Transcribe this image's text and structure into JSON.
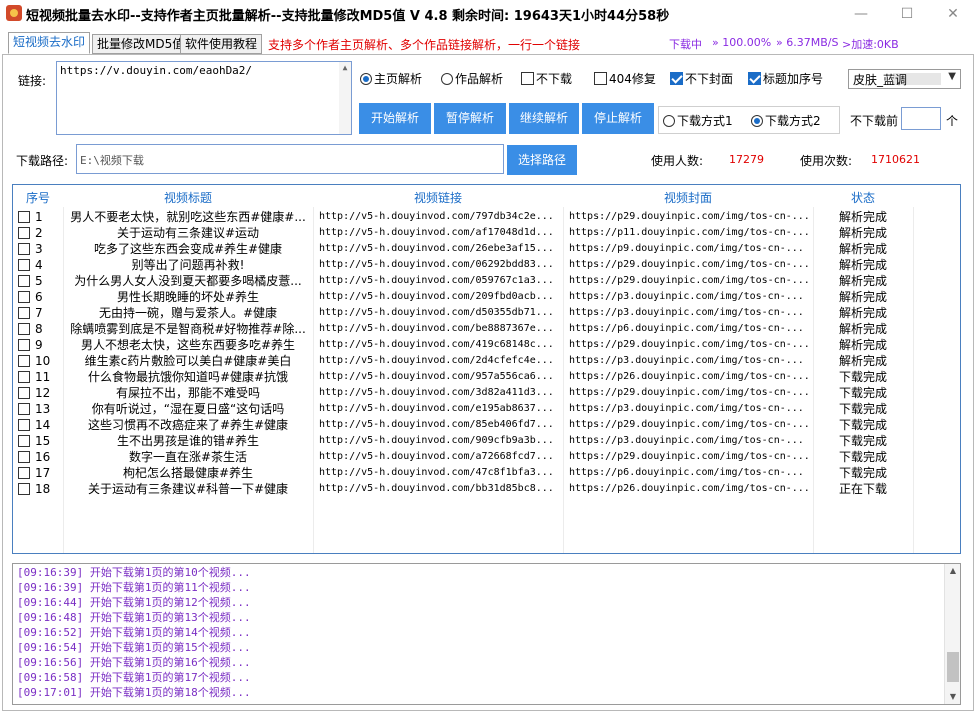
{
  "app": {
    "title": "短视频批量去水印--支持作者主页批量解析--支持批量修改MD5值 V 4.8     剩余时间:  19643天1小时44分58秒"
  },
  "window_controls": {
    "minimize": "—",
    "maximize": "☐",
    "close": "✕"
  },
  "tabs": [
    {
      "label": "短视频去水印",
      "active": true
    },
    {
      "label": "批量修改MD5值",
      "active": false
    },
    {
      "label": "软件使用教程",
      "active": false
    }
  ],
  "tab_hint": "支持多个作者主页解析、多个作品链接解析，一行一个链接",
  "status": {
    "downloading": "下载中",
    "percent": "» 100.00%",
    "speed": "» 6.37MB/S",
    "accel": ">加速:0KB"
  },
  "link": {
    "label": "链接:",
    "value": "https://v.douyin.com/eaohDa2/"
  },
  "options": {
    "homepage_parse": "主页解析",
    "work_parse": "作品解析",
    "no_download": "不下载",
    "fix_404": "404修复",
    "no_cover": "不下封面",
    "title_index": "标题加序号"
  },
  "skin": {
    "value": "皮肤_蓝调"
  },
  "buttons": {
    "start": "开始解析",
    "pause": "暂停解析",
    "resume": "继续解析",
    "stop": "停止解析",
    "choose_path": "选择路径"
  },
  "download_mode": {
    "mode1": "下载方式1",
    "mode2": "下载方式2"
  },
  "download_before": {
    "label": "不下载前",
    "unit": "个",
    "value": ""
  },
  "path": {
    "label": "下载路径:",
    "value": "E:\\视频下载"
  },
  "stats": {
    "users_label": "使用人数:",
    "users_value": "17279",
    "uses_label": "使用次数:",
    "uses_value": "1710621"
  },
  "table": {
    "headers": {
      "index": "序号",
      "title": "视频标题",
      "link": "视频链接",
      "cover": "视频封面",
      "status": "状态"
    },
    "rows": [
      {
        "i": "1",
        "title": "男人不要老太快，就别吃这些东西#健康#...",
        "link": "http://v5-h.douyinvod.com/797db34c2e...",
        "cover": "https://p29.douyinpic.com/img/tos-cn-...",
        "status": "解析完成"
      },
      {
        "i": "2",
        "title": "关于运动有三条建议#运动",
        "link": "http://v5-h.douyinvod.com/af17048d1d...",
        "cover": "https://p11.douyinpic.com/img/tos-cn-...",
        "status": "解析完成"
      },
      {
        "i": "3",
        "title": "吃多了这些东西会变成#养生#健康",
        "link": "http://v5-h.douyinvod.com/26ebe3af15...",
        "cover": "https://p9.douyinpic.com/img/tos-cn-...",
        "status": "解析完成"
      },
      {
        "i": "4",
        "title": "别等出了问题再补救!",
        "link": "http://v5-h.douyinvod.com/06292bdd83...",
        "cover": "https://p29.douyinpic.com/img/tos-cn-...",
        "status": "解析完成"
      },
      {
        "i": "5",
        "title": "为什么男人女人没到夏天都要多喝橘皮薏...",
        "link": "http://v5-h.douyinvod.com/059767c1a3...",
        "cover": "https://p29.douyinpic.com/img/tos-cn-...",
        "status": "解析完成"
      },
      {
        "i": "6",
        "title": "男性长期晚睡的坏处#养生",
        "link": "http://v5-h.douyinvod.com/209fbd0acb...",
        "cover": "https://p3.douyinpic.com/img/tos-cn-...",
        "status": "解析完成"
      },
      {
        "i": "7",
        "title": "无由持一碗，赠与爱茶人。#健康",
        "link": "http://v5-h.douyinvod.com/d50355db71...",
        "cover": "https://p3.douyinpic.com/img/tos-cn-...",
        "status": "解析完成"
      },
      {
        "i": "8",
        "title": "除螨喷雾到底是不是智商税#好物推荐#除...",
        "link": "http://v5-h.douyinvod.com/be8887367e...",
        "cover": "https://p6.douyinpic.com/img/tos-cn-...",
        "status": "解析完成"
      },
      {
        "i": "9",
        "title": "男人不想老太快，这些东西要多吃#养生",
        "link": "http://v5-h.douyinvod.com/419c68148c...",
        "cover": "https://p29.douyinpic.com/img/tos-cn-...",
        "status": "解析完成"
      },
      {
        "i": "10",
        "title": "维生素c药片敷脸可以美白#健康#美白",
        "link": "http://v5-h.douyinvod.com/2d4cfefc4e...",
        "cover": "https://p3.douyinpic.com/img/tos-cn-...",
        "status": "解析完成"
      },
      {
        "i": "11",
        "title": "什么食物最抗饿你知道吗#健康#抗饿",
        "link": "http://v5-h.douyinvod.com/957a556ca6...",
        "cover": "https://p26.douyinpic.com/img/tos-cn-...",
        "status": "下载完成"
      },
      {
        "i": "12",
        "title": "有屎拉不出，那能不难受吗",
        "link": "http://v5-h.douyinvod.com/3d82a411d3...",
        "cover": "https://p29.douyinpic.com/img/tos-cn-...",
        "status": "下载完成"
      },
      {
        "i": "13",
        "title": "你有听说过，“湿在夏日盛“这句话吗",
        "link": "http://v5-h.douyinvod.com/e195ab8637...",
        "cover": "https://p3.douyinpic.com/img/tos-cn-...",
        "status": "下载完成"
      },
      {
        "i": "14",
        "title": "这些习惯再不改癌症来了#养生#健康",
        "link": "http://v5-h.douyinvod.com/85eb406fd7...",
        "cover": "https://p29.douyinpic.com/img/tos-cn-...",
        "status": "下载完成"
      },
      {
        "i": "15",
        "title": "生不出男孩是谁的错#养生",
        "link": "http://v5-h.douyinvod.com/909cfb9a3b...",
        "cover": "https://p3.douyinpic.com/img/tos-cn-...",
        "status": "下载完成"
      },
      {
        "i": "16",
        "title": "数字一直在涨#茶生活",
        "link": "http://v5-h.douyinvod.com/a72668fcd7...",
        "cover": "https://p29.douyinpic.com/img/tos-cn-...",
        "status": "下载完成"
      },
      {
        "i": "17",
        "title": "枸杞怎么搭最健康#养生",
        "link": "http://v5-h.douyinvod.com/47c8f1bfa3...",
        "cover": "https://p6.douyinpic.com/img/tos-cn-...",
        "status": "下载完成"
      },
      {
        "i": "18",
        "title": "关于运动有三条建议#科普一下#健康",
        "link": "http://v5-h.douyinvod.com/bb31d85bc8...",
        "cover": "https://p26.douyinpic.com/img/tos-cn-...",
        "status": "正在下载"
      }
    ]
  },
  "log": [
    "[09:16:39] 开始下载第1页的第10个视频...",
    "[09:16:39] 开始下载第1页的第11个视频...",
    "[09:16:44] 开始下载第1页的第12个视频...",
    "[09:16:48] 开始下载第1页的第13个视频...",
    "[09:16:52] 开始下载第1页的第14个视频...",
    "[09:16:54] 开始下载第1页的第15个视频...",
    "[09:16:56] 开始下载第1页的第16个视频...",
    "[09:16:58] 开始下载第1页的第17个视频...",
    "[09:17:01] 开始下载第1页的第18个视频..."
  ]
}
